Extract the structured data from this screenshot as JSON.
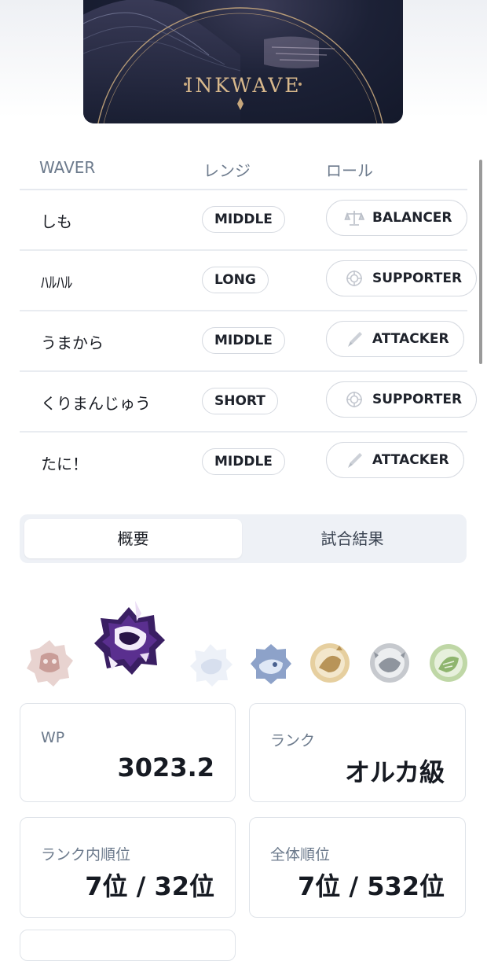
{
  "banner": {
    "title": "INKWAVE"
  },
  "table": {
    "headers": {
      "waver": "WAVER",
      "range": "レンジ",
      "role": "ロール"
    },
    "rows": [
      {
        "name": "しも",
        "range": "MIDDLE",
        "role": "BALANCER",
        "role_icon": "balance-scale-icon"
      },
      {
        "name": "ﾊﾙﾊﾙ",
        "range": "LONG",
        "role": "SUPPORTER",
        "role_icon": "target-icon"
      },
      {
        "name": "うまから",
        "range": "MIDDLE",
        "role": "ATTACKER",
        "role_icon": "brush-icon"
      },
      {
        "name": "くりまんじゅう",
        "range": "SHORT",
        "role": "SUPPORTER",
        "role_icon": "target-icon"
      },
      {
        "name": "たに！",
        "range": "MIDDLE",
        "role": "ATTACKER",
        "role_icon": "brush-icon"
      }
    ]
  },
  "tabs": {
    "overview": "概要",
    "results": "試合結果"
  },
  "emblems": [
    "emblem-rose",
    "emblem-orca-selected",
    "emblem-white",
    "emblem-blue",
    "emblem-gold",
    "emblem-silver",
    "emblem-green"
  ],
  "stats": {
    "wp": {
      "label": "WP",
      "value": "3023.2"
    },
    "rank": {
      "label": "ランク",
      "value": "オルカ級"
    },
    "rank_position": {
      "label": "ランク内順位",
      "value": "7位 / 32位"
    },
    "overall_position": {
      "label": "全体順位",
      "value": "7位 / 532位"
    }
  },
  "colors": {
    "banner_bg": "#1c2136",
    "banner_gold": "#d8b88c",
    "label_gray": "#6c7a8c",
    "border": "#dfe3e9",
    "tab_bg": "#eef1f6"
  }
}
